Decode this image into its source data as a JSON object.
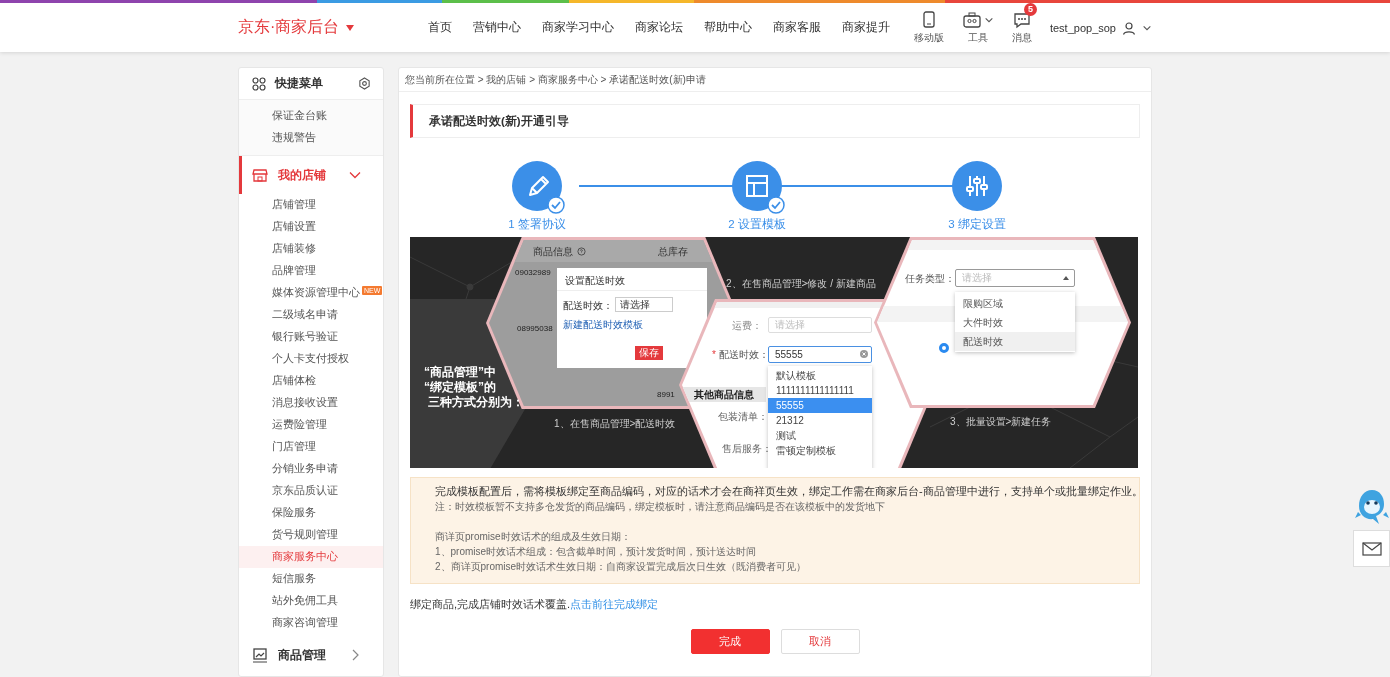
{
  "header": {
    "logo": "京东·商家后台",
    "nav": [
      {
        "label": "首页"
      },
      {
        "label": "营销中心"
      },
      {
        "label": "商家学习中心"
      },
      {
        "label": "商家论坛"
      },
      {
        "label": "帮助中心"
      },
      {
        "label": "商家客服"
      },
      {
        "label": "商家提升"
      }
    ],
    "tools": [
      {
        "kind": "mobile",
        "label": "移动版"
      },
      {
        "kind": "tools",
        "label": "工具"
      },
      {
        "kind": "messages",
        "label": "消息",
        "badge": "5"
      }
    ],
    "user": "test_pop_sop"
  },
  "sidebar": {
    "quick_menu": {
      "title": "快捷菜单",
      "items": [
        "保证金台账",
        "违规警告"
      ]
    },
    "groups": [
      {
        "title": "我的店铺",
        "expanded": true,
        "items": [
          {
            "label": "店铺管理",
            "selected": false
          },
          {
            "label": "店铺设置",
            "selected": false
          },
          {
            "label": "店铺装修",
            "selected": false
          },
          {
            "label": "品牌管理",
            "selected": false
          },
          {
            "label": "媒体资源管理中心",
            "badge": "NEW",
            "selected": false
          },
          {
            "label": "二级域名申请",
            "selected": false
          },
          {
            "label": "银行账号验证",
            "selected": false
          },
          {
            "label": "个人卡支付授权",
            "selected": false
          },
          {
            "label": "店铺体检",
            "selected": false
          },
          {
            "label": "消息接收设置",
            "selected": false
          },
          {
            "label": "运费险管理",
            "selected": false
          },
          {
            "label": "门店管理",
            "selected": false
          },
          {
            "label": "分销业务申请",
            "selected": false
          },
          {
            "label": "京东品质认证",
            "selected": false
          },
          {
            "label": "保险服务",
            "selected": false
          },
          {
            "label": "货号规则管理",
            "selected": false
          },
          {
            "label": "商家服务中心",
            "selected": true
          },
          {
            "label": "短信服务",
            "selected": false
          },
          {
            "label": "站外免佣工具",
            "selected": false
          },
          {
            "label": "商家咨询管理",
            "selected": false
          }
        ]
      },
      {
        "title": "商品管理",
        "expanded": false
      }
    ]
  },
  "breadcrumb": "您当前所在位置 > 我的店铺 > 商家服务中心 > 承诺配送时效(新)申请",
  "panel_title": "承诺配送时效(新)开通引导",
  "steps": [
    {
      "label": "1 签署协议",
      "done": true
    },
    {
      "label": "2 设置模板",
      "done": true
    },
    {
      "label": "3 绑定设置",
      "done": false
    }
  ],
  "guide": {
    "intro": [
      "“商品管理”中",
      "“绑定模板”的",
      "三种方式分别为："
    ],
    "captions": [
      "1、在售商品管理>配送时效",
      "2、在售商品管理>修改 / 新建商品",
      "3、批量设置>新建任务"
    ],
    "panels": [
      {
        "kind": "list_modal",
        "table_headers": [
          "商品信息",
          "总库存"
        ],
        "codes": [
          "09032989",
          "08995038",
          "8991"
        ],
        "modal_title": "设置配送时效",
        "field_label": "配送时效：",
        "placeholder": "请选择",
        "link": "新建配送时效模板",
        "save": "保存"
      },
      {
        "kind": "edit_form",
        "freight_label": "运费：",
        "freight_placeholder": "请选择",
        "required_mark": "*",
        "field_label": "配送时效：",
        "value": "55555",
        "options": [
          {
            "label": "默认模板",
            "selected": false
          },
          {
            "label": "1111111111111111",
            "selected": false
          },
          {
            "label": "55555",
            "selected": true
          },
          {
            "label": "21312",
            "selected": false
          },
          {
            "label": "测试",
            "selected": false
          },
          {
            "label": "雷顿定制模板",
            "selected": false
          }
        ],
        "section": "其他商品信息",
        "labels": [
          "包装清单：",
          "售后服务："
        ]
      },
      {
        "kind": "batch_task",
        "field_label": "任务类型：",
        "placeholder": "请选择",
        "radio_checked": true,
        "options": [
          {
            "label": "限购区域",
            "selected": false
          },
          {
            "label": "大件时效",
            "selected": false
          },
          {
            "label": "配送时效",
            "selected": true
          }
        ]
      }
    ]
  },
  "notice": {
    "lines": [
      {
        "kind": "main",
        "text": "完成模板配置后，需将模板绑定至商品编码，对应的话术才会在商祥页生效，绑定工作需在商家后台-商品管理中进行，支持单个或批量绑定作业。"
      },
      {
        "kind": "note",
        "text": "注：时效模板暂不支持多仓发货的商品编码，绑定模板时，请注意商品编码是否在该模板中的发货地下"
      },
      {
        "kind": "heading",
        "text": "商详页promise时效话术的组成及生效日期："
      },
      {
        "kind": "item",
        "text": "1、promise时效话术组成：包含截单时间，预计发货时间，预计送达时间"
      },
      {
        "kind": "item",
        "text": "2、商详页promise时效话术生效日期：自商家设置完成后次日生效（既消费者可见）"
      }
    ]
  },
  "bind": {
    "text": "绑定商品,完成店铺时效话术覆盖.",
    "link": "点击前往完成绑定"
  },
  "buttons": [
    {
      "label": "完成",
      "kind": "primary"
    },
    {
      "label": "取消",
      "kind": "secondary"
    }
  ]
}
